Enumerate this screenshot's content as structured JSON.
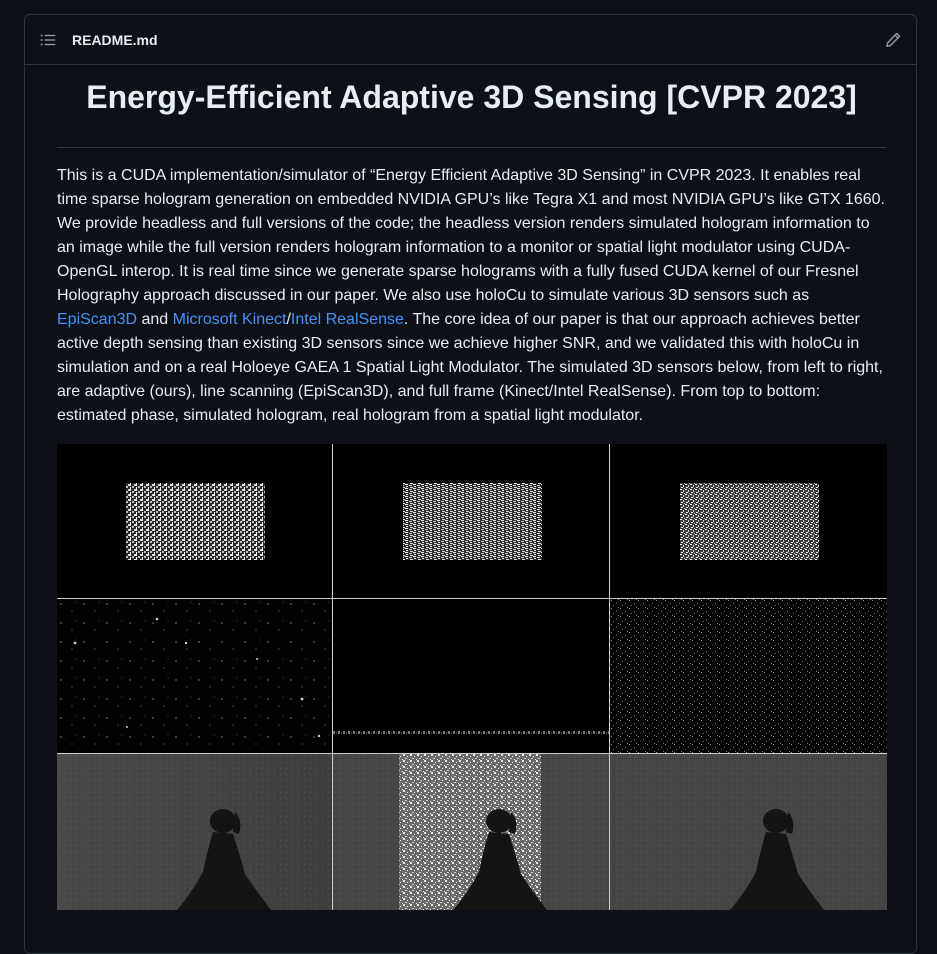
{
  "header": {
    "file_name": "README.md",
    "toc_icon": "list-unordered-icon",
    "edit_icon": "pencil-icon"
  },
  "readme": {
    "title": "Energy-Efficient Adaptive 3D Sensing [CVPR 2023]",
    "para_part1": "This is a CUDA implementation/simulator of “Energy Efficient Adaptive 3D Sensing” in CVPR 2023. It enables real time sparse hologram generation on embedded NVIDIA GPU’s like Tegra X1 and most NVIDIA GPU’s like GTX 1660. We provide headless and full versions of the code; the headless version renders simulated hologram information to an image while the full version renders hologram information to a monitor or spatial light modulator using CUDA-OpenGL interop. It is real time since we generate sparse holograms with a fully fused CUDA kernel of our Fresnel Holography approach discussed in our paper. We also use holoCu to simulate various 3D sensors such as ",
    "link_episcan": "EpiScan3D",
    "para_part2": " and ",
    "link_kinect": "Microsoft Kinect",
    "para_part3": "/",
    "link_realsense": "Intel RealSense",
    "para_part4": ". The core idea of our paper is that our approach achieves better active depth sensing than existing 3D sensors since we achieve higher SNR, and we validated this with holoCu in simulation and on a real Holoeye GAEA 1 Spatial Light Modulator. The simulated 3D sensors below, from left to right, are adaptive (ours), line scanning (EpiScan3D), and full frame (Kinect/Intel RealSense). From top to bottom: estimated phase, simulated hologram, real hologram from a spatial light modulator."
  },
  "colors": {
    "background": "#0d1117",
    "border": "#30363d",
    "text": "#e6edf3",
    "link": "#4493f8"
  }
}
